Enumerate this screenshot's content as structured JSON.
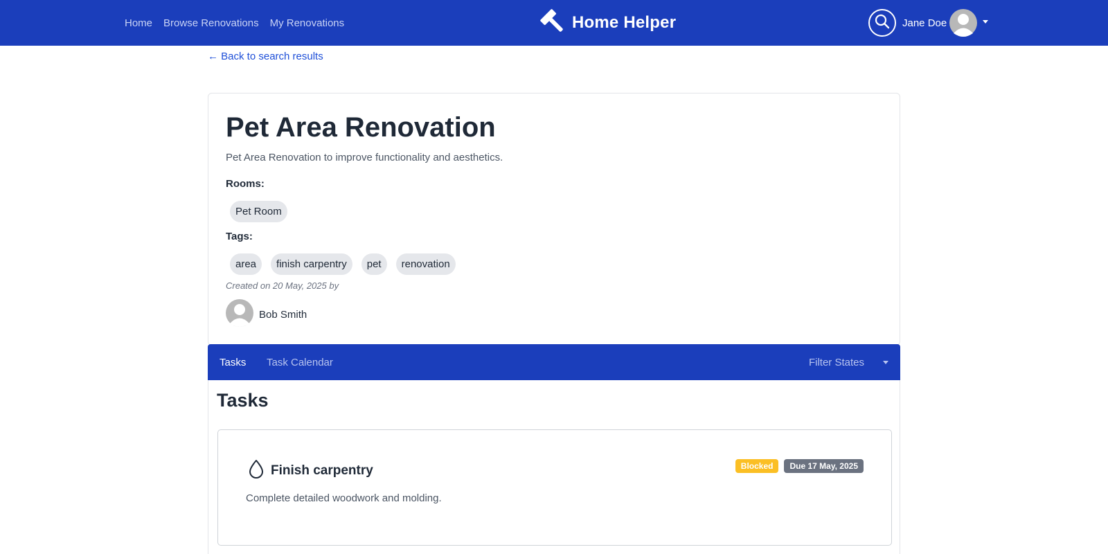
{
  "navbar": {
    "links": [
      "Home",
      "Browse Renovations",
      "My Renovations"
    ],
    "brand": "Home Helper",
    "brand_icon": "hammer-icon",
    "user_name": "Jane Doe",
    "bg_color": "#1b3ebb"
  },
  "back_link": "← Back to search results",
  "renovation": {
    "title": "Pet Area Renovation",
    "description": "Pet Area Renovation to improve functionality and aesthetics.",
    "rooms_label": "Rooms:",
    "rooms": [
      "Pet Room"
    ],
    "tags_label": "Tags:",
    "tags": [
      "area",
      "finish carpentry",
      "pet",
      "renovation"
    ],
    "created": "Created on 20 May, 2025 by",
    "creator": "Bob Smith"
  },
  "tabs": {
    "items": [
      "Tasks",
      "Task Calendar"
    ],
    "active": "Tasks",
    "filter_label": "Filter States"
  },
  "tasks": {
    "heading": "Tasks",
    "items": [
      {
        "icon": "droplet-icon",
        "title": "Finish carpentry",
        "description": "Complete detailed woodwork and molding.",
        "status": "Blocked",
        "status_color": "#fbbf24",
        "due": "Due 17 May, 2025"
      }
    ]
  }
}
